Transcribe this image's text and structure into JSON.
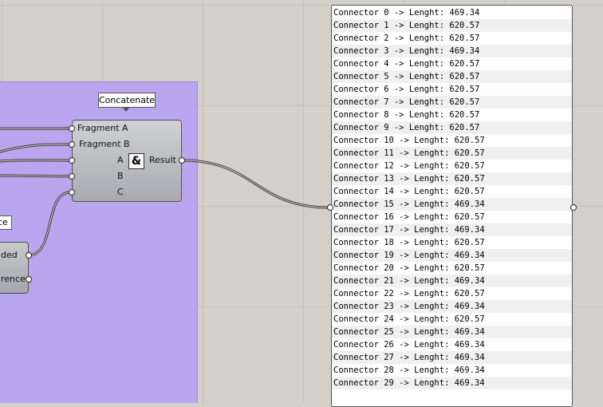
{
  "tooltip": "Concatenate",
  "component": {
    "inputs_top": [
      "Fragment A",
      "Fragment B"
    ],
    "inputs": [
      "A",
      "B",
      "C"
    ],
    "icon": "&",
    "output": "Result"
  },
  "left_component": {
    "out1": "ded",
    "out2": "rence"
  },
  "partial_label": "ce",
  "panel": {
    "lines": [
      "Connector 0 -> Lenght: 469.34",
      "Connector 1 -> Lenght: 620.57",
      "Connector 2 -> Lenght: 620.57",
      "Connector 3 -> Lenght: 469.34",
      "Connector 4 -> Lenght: 620.57",
      "Connector 5 -> Lenght: 620.57",
      "Connector 6 -> Lenght: 620.57",
      "Connector 7 -> Lenght: 620.57",
      "Connector 8 -> Lenght: 620.57",
      "Connector 9 -> Lenght: 620.57",
      "Connector 10 -> Lenght: 620.57",
      "Connector 11 -> Lenght: 620.57",
      "Connector 12 -> Lenght: 620.57",
      "Connector 13 -> Lenght: 620.57",
      "Connector 14 -> Lenght: 620.57",
      "Connector 15 -> Lenght: 469.34",
      "Connector 16 -> Lenght: 620.57",
      "Connector 17 -> Lenght: 469.34",
      "Connector 18 -> Lenght: 620.57",
      "Connector 19 -> Lenght: 469.34",
      "Connector 20 -> Lenght: 620.57",
      "Connector 21 -> Lenght: 469.34",
      "Connector 22 -> Lenght: 620.57",
      "Connector 23 -> Lenght: 469.34",
      "Connector 24 -> Lenght: 620.57",
      "Connector 25 -> Lenght: 469.34",
      "Connector 26 -> Lenght: 469.34",
      "Connector 27 -> Lenght: 469.34",
      "Connector 28 -> Lenght: 469.34",
      "Connector 29 -> Lenght: 469.34"
    ]
  },
  "colors": {
    "canvas": "#d3d0c9",
    "group": "#b9a6ee",
    "wire": "#2e2e2e"
  }
}
